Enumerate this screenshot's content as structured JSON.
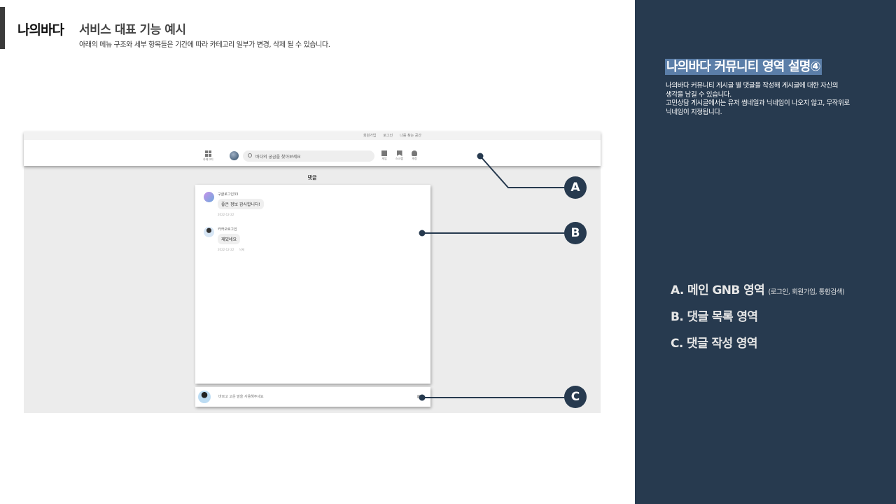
{
  "header": {
    "brand": "나의바다",
    "title": "서비스 대표 기능 예시",
    "subtitle": "아래의 메뉴 구조와 세부 항목들은 기간에 따라 카테고리 일부가 변경, 삭제 될 수 있습니다."
  },
  "mockup": {
    "gnb": {
      "top_links": [
        "회원가입",
        "로그인",
        "나를 찾는 공간"
      ],
      "menu_label": "카테고리",
      "search_placeholder": "바다의 궁금을 찾아보세요",
      "icons": [
        {
          "icon": "image-icon",
          "label": "게임"
        },
        {
          "icon": "bookmark-icon",
          "label": "스크랩"
        },
        {
          "icon": "person-icon",
          "label": "계정"
        }
      ]
    },
    "section_title": "댓글",
    "comments": [
      {
        "author": "구글로그인33",
        "text": "좋은 정보 감사합니다!",
        "date": "2022-12-22",
        "action": ""
      },
      {
        "author": "카카오로그인",
        "text": "재밌네요",
        "date": "2022-12-22",
        "action": "삭제"
      }
    ],
    "write": {
      "placeholder": "바르고 고운 말을 사용해주세요"
    }
  },
  "callouts": [
    "A",
    "B",
    "C"
  ],
  "panel": {
    "title": "나의바다 커뮤니티 영역 설명④",
    "description": [
      "나의바다 커뮤니티 게시글 별 댓글을 작성해 게시글에 대한 자신의",
      "생각을 남길 수 있습니다.",
      "고민상담 게시글에서는 유저 썸네일과 닉네임이 나오지 않고, 무작위로",
      "닉네임이 지정됩니다."
    ],
    "legend": [
      {
        "label": "A. 메인 GNB 영역",
        "note": "(로그인, 회원가입, 통합검색)"
      },
      {
        "label": "B. 댓글 목록 영역",
        "note": ""
      },
      {
        "label": "C. 댓글 작성 영역",
        "note": ""
      }
    ]
  },
  "colors": {
    "panel_bg": "#273a4f",
    "title_highlight": "#5b7ea8",
    "callout": "#273a4f"
  }
}
